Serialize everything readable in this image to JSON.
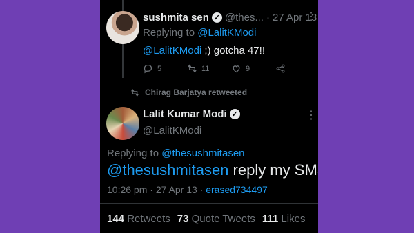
{
  "tweet1": {
    "display_name": "sushmita sen",
    "handle_truncated": "@thes...",
    "separator": "·",
    "date": "27 Apr 13",
    "replying_prefix": "Replying to",
    "replying_handle": "@LalitKModi",
    "mention": "@LalitKModi",
    "text": " ;) gotcha 47!!",
    "reply_count": "5",
    "retweet_count": "11",
    "like_count": "9"
  },
  "retweet_banner": "Chirag Barjatya retweeted",
  "tweet2": {
    "display_name": "Lalit Kumar Modi",
    "handle": "@LalitKModi",
    "replying_prefix": "Replying to",
    "replying_handle": "@thesushmitasen",
    "mention": "@thesushmitasen",
    "text": " reply my SMS",
    "time": "10:26 pm",
    "date": "27 Apr 13",
    "source": "erased734497",
    "retweets": "144",
    "retweets_label": "Retweets",
    "quotes": "73",
    "quotes_label": "Quote Tweets",
    "likes": "111",
    "likes_label": "Likes"
  },
  "icons": [
    "verified-icon",
    "more-icon",
    "reply-icon",
    "retweet-icon",
    "like-icon",
    "share-icon"
  ]
}
